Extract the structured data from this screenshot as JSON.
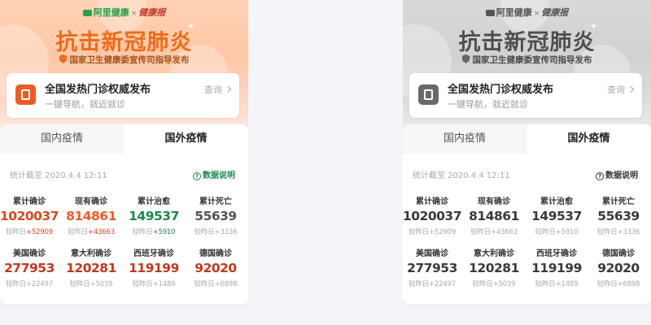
{
  "header": {
    "brand_ali": "阿里健康",
    "brand_x": "×",
    "brand_jk": "健康报",
    "title": "抗击新冠肺炎",
    "subtitle": "国家卫生健康委宣传司指导发布"
  },
  "notice": {
    "title": "全国发热门诊权威发布",
    "subtitle": "一键导航，就近就诊",
    "link": "查询"
  },
  "tabs": {
    "domestic": "国内疫情",
    "foreign": "国外疫情",
    "active": "foreign"
  },
  "stats": {
    "timestamp": "统计截至 2020.4.4 12:11",
    "explain_label": "数据说明",
    "delta_prefix": "较昨日",
    "items": [
      {
        "label": "累计确诊",
        "value": "1020037",
        "delta": "+52909",
        "color": "#e0451d"
      },
      {
        "label": "现有确诊",
        "value": "814861",
        "delta": "+43663",
        "color": "#f05a24"
      },
      {
        "label": "累计治愈",
        "value": "149537",
        "delta": "+5910",
        "color": "#1b8a4c"
      },
      {
        "label": "累计死亡",
        "value": "55639",
        "delta": "+3336",
        "color": "#555555"
      },
      {
        "label": "美国确诊",
        "value": "277953",
        "delta": "+22497",
        "color": "#c2381b"
      },
      {
        "label": "意大利确诊",
        "value": "120281",
        "delta": "+5039",
        "color": "#c2381b"
      },
      {
        "label": "西班牙确诊",
        "value": "119199",
        "delta": "+1489",
        "color": "#c2381b"
      },
      {
        "label": "德国确诊",
        "value": "92020",
        "delta": "+6898",
        "color": "#c2381b"
      }
    ]
  },
  "colors": {
    "accent": "#ee6c1a",
    "green": "#1b8a4c",
    "red_delta": "#e0451d",
    "green_delta": "#1b8a4c"
  }
}
